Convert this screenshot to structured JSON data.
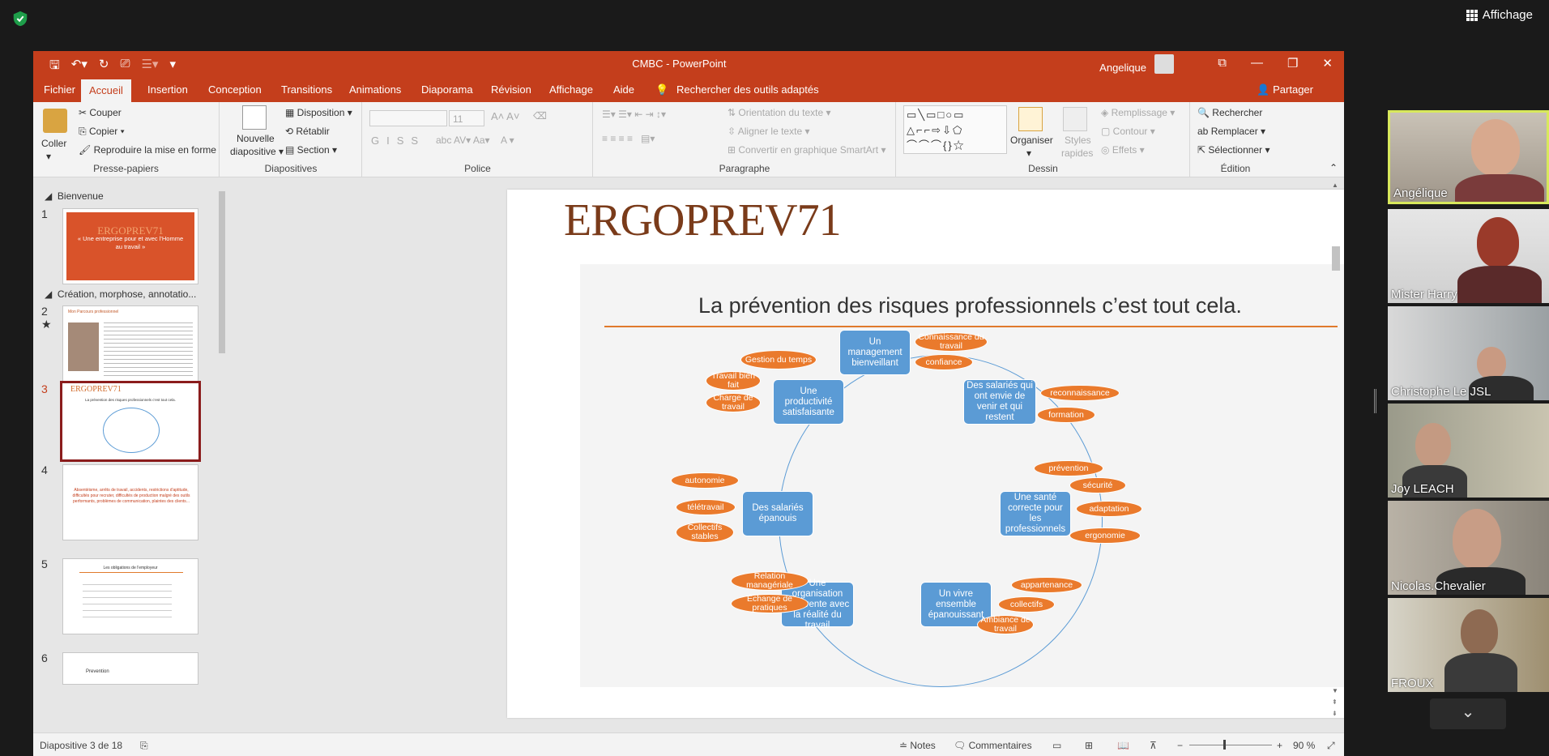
{
  "zoom": {
    "view_label": "Affichage",
    "participants": [
      {
        "name": "Angélique"
      },
      {
        "name": "Mister Harry"
      },
      {
        "name": "Christophe Le JSL"
      },
      {
        "name": "Joy LEACH"
      },
      {
        "name": "Nicolas.Chevalier"
      },
      {
        "name": "FROUX"
      }
    ],
    "down_icon": "chevron-down-icon"
  },
  "ppt": {
    "title": "CMBC  -  PowerPoint",
    "user": "Angelique",
    "tabs": [
      "Fichier",
      "Accueil",
      "Insertion",
      "Conception",
      "Transitions",
      "Animations",
      "Diaporama",
      "Révision",
      "Affichage",
      "Aide"
    ],
    "active_tab": "Accueil",
    "search_tools": "Rechercher des outils adaptés",
    "share": "Partager",
    "ribbon": {
      "clipboard": {
        "paste": "Coller",
        "cut": "Couper",
        "copy": "Copier",
        "format_painter": "Reproduire la mise en forme",
        "label": "Presse-papiers"
      },
      "slides": {
        "new_slide_1": "Nouvelle",
        "new_slide_2": "diapositive",
        "layout": "Disposition",
        "reset": "Rétablir",
        "section": "Section",
        "label": "Diapositives"
      },
      "font": {
        "size": "11",
        "label": "Police"
      },
      "paragraph": {
        "text_direction": "Orientation du texte",
        "align_text": "Aligner le texte",
        "smartart": "Convertir en graphique SmartArt",
        "label": "Paragraphe"
      },
      "drawing": {
        "arrange": "Organiser",
        "quick_styles_1": "Styles",
        "quick_styles_2": "rapides",
        "fill": "Remplissage",
        "outline": "Contour",
        "effects": "Effets",
        "label": "Dessin"
      },
      "editing": {
        "find": "Rechercher",
        "replace": "Remplacer",
        "select": "Sélectionner",
        "label": "Édition"
      }
    },
    "thumbnails": {
      "section1": "Bienvenue",
      "section2": "Création, morphose, annotatio...",
      "numbers": [
        "1",
        "2",
        "3",
        "4",
        "5",
        "6"
      ],
      "slide1_line1": "« Une entreprise pour et avec l'Homme",
      "slide1_line2": "au travail »",
      "slide2_title": "Mon Parcours professionnel",
      "slide3_title": "La prévention des risques professionnels c'est tout cela.",
      "slide4_text": "Absentéisme, arrêts de travail, accidents, restrictions d'aptitude, difficultés pour recruter, difficultés de production malgré des outils performants, problèmes de communication, plaintes des clients...",
      "slide5_title": "Les obligations de l'employeur",
      "slide6_label": "Prevention"
    },
    "slide": {
      "logo_a": "ERGO",
      "logo_b": "PREV71",
      "title": "La prévention des risques professionnels c’est tout cela.",
      "boxes": [
        "Un management bienveillant",
        "Des salariés qui ont envie de venir et qui restent",
        "Une santé correcte pour les professionnels",
        "Un vivre ensemble épanouissant",
        "Une organisation cohérente avec la réalité du travail",
        "Des salariés épanouis",
        "Une productivité satisfaisante"
      ],
      "ovals": [
        "Connaissance du travail",
        "confiance",
        "reconnaissance",
        "formation",
        "prévention",
        "sécurité",
        "adaptation",
        "ergonomie",
        "appartenance",
        "collectifs",
        "Ambiance de travail",
        "Relation managériale",
        "Échange de pratiques",
        "autonomie",
        "télétravail",
        "Collectifs stables",
        "Gestion du temps",
        "Travail bien fait",
        "Charge de travail"
      ]
    },
    "status": {
      "slide_pos": "Diapositive 3 de 18",
      "notes": "Notes",
      "comments": "Commentaires",
      "zoom": "90 %"
    }
  }
}
